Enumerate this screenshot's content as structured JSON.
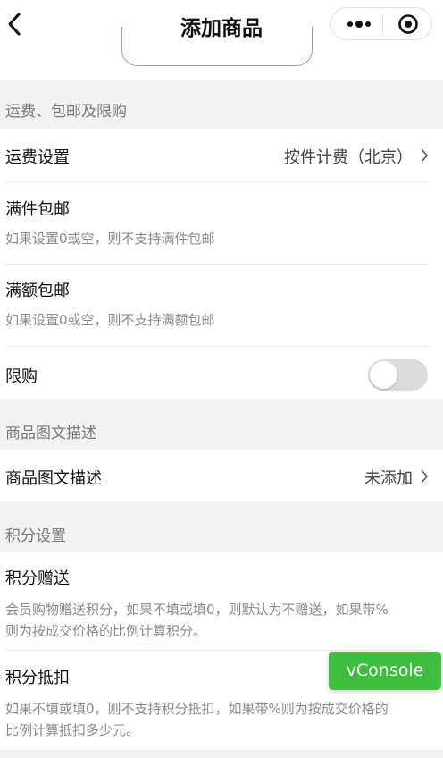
{
  "navbar": {
    "title": "添加商品",
    "back_icon": "chevron-left-icon",
    "more_icon": "more-dots-icon",
    "close_icon": "target-circle-icon"
  },
  "sections": {
    "shipping": {
      "header": "运费、包邮及限购",
      "freight_label": "运费设置",
      "freight_value": "按件计费（北京）",
      "free_by_count_label": "满件包邮",
      "free_by_count_desc": "如果设置0或空，则不支持满件包邮",
      "free_by_amount_label": "满额包邮",
      "free_by_amount_desc": "如果设置0或空，则不支持满额包邮",
      "limit_label": "限购",
      "limit_enabled": false
    },
    "description": {
      "header": "商品图文描述",
      "label": "商品图文描述",
      "value": "未添加"
    },
    "points": {
      "header": "积分设置",
      "gift_label": "积分赠送",
      "gift_desc_line1": "会员购物赠送积分，如果不填或填0，则默认为不赠送，如果带%",
      "gift_desc_line2": "则为按成交价格的比例计算积分。",
      "deduct_label": "积分抵扣",
      "deduct_desc_line1": "如果不填或填0，则不支持积分抵扣，如果带%则为按成交价格的",
      "deduct_desc_line2": "比例计算抵扣多少元。"
    }
  },
  "vconsole": {
    "label": "vConsole",
    "color": "#3fbd3f"
  }
}
